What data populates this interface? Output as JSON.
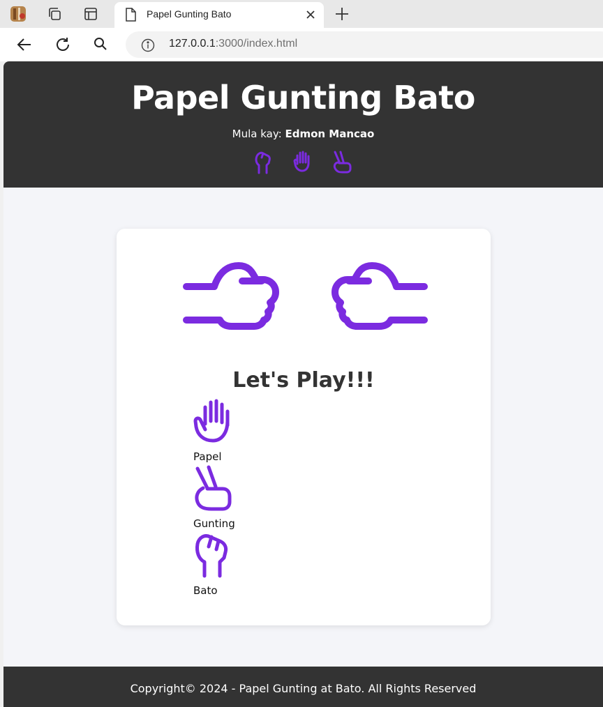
{
  "browser": {
    "tab_title": "Papel Gunting Bato",
    "url_host": "127.0.0.1",
    "url_rest": ":3000/index.html"
  },
  "header": {
    "title": "Papel Gunting Bato",
    "byline_prefix": "Mula kay:",
    "author": "Edmon Mancao"
  },
  "game": {
    "status": "Let's Play!!!",
    "choices": [
      {
        "label": "Papel",
        "icon": "paper-hand-icon"
      },
      {
        "label": "Gunting",
        "icon": "scissors-hand-icon"
      },
      {
        "label": "Bato",
        "icon": "rock-hand-icon"
      }
    ]
  },
  "footer": {
    "copyright": "Copyright© 2024 - Papel Gunting at Bato. All Rights Reserved"
  },
  "colors": {
    "accent": "#7b2be0",
    "header_bg": "#333333",
    "page_bg": "#f4f5f9"
  }
}
